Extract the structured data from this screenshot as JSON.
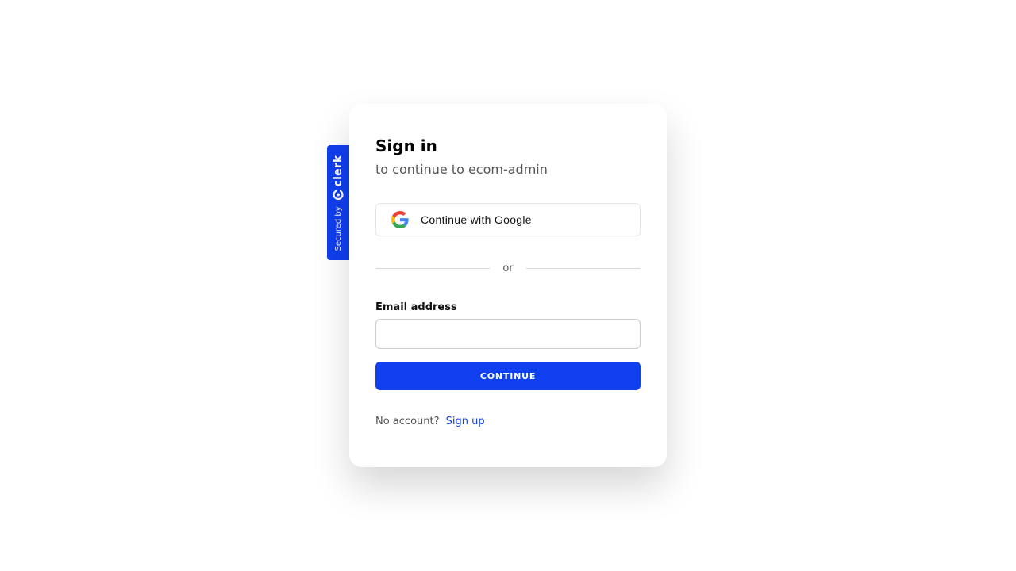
{
  "badge": {
    "secured_by": "Secured by",
    "brand": "clerk"
  },
  "signin": {
    "title": "Sign in",
    "subtitle": "to continue to ecom-admin",
    "google_button_label": "Continue with Google",
    "divider_text": "or",
    "email_label": "Email address",
    "email_value": "",
    "email_placeholder": "",
    "continue_label": "CONTINUE",
    "no_account_text": "No account?",
    "signup_label": "Sign up"
  },
  "icons": {
    "google": "google-icon",
    "clerk": "clerk-logo-icon"
  },
  "colors": {
    "accent": "#103fef",
    "text_primary": "#111111",
    "text_secondary": "#555555"
  }
}
